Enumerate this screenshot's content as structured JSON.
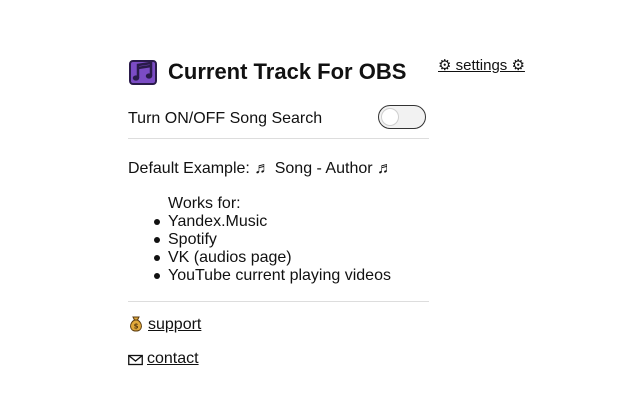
{
  "header": {
    "title": "Current Track For OBS",
    "logo_icon": "music-notes-icon",
    "settings_label": "⚙ settings ⚙"
  },
  "toggle": {
    "label": "Turn ON/OFF Song Search",
    "state": "off"
  },
  "example": {
    "text": "Default Example: ♬ Song - Author ♬"
  },
  "works": {
    "heading": "Works for:",
    "items": [
      "Yandex.Music",
      "Spotify",
      "VK (audios page)",
      "YouTube current playing videos"
    ]
  },
  "links": {
    "support_icon": "money-bag-icon",
    "support_label": "support",
    "contact_icon": "envelope-icon",
    "contact_label": "contact"
  },
  "colors": {
    "logo_purple": "#7b4cc4",
    "logo_dark": "#2a1b4a",
    "bag_gold": "#e0a83a"
  }
}
